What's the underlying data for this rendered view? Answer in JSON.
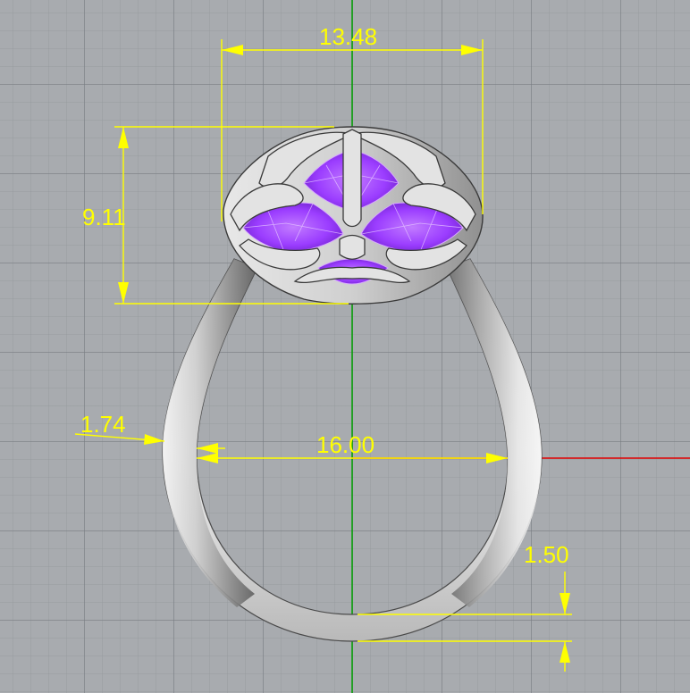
{
  "viewport": {
    "name": "Rhino front viewport",
    "colors": {
      "background": "#a8abaf",
      "grid_minor": "#969a9e",
      "grid_major": "#787c82",
      "x_axis": "#e00000",
      "y_axis": "#00a000",
      "dimension": "#ffff00",
      "metal": "#d9d9d9",
      "gem": "#9b3dff"
    }
  },
  "dimensions": {
    "top_width": "13.48",
    "head_height": "9.11",
    "shank_side": "1.74",
    "inner_diameter": "16.00",
    "band_bottom": "1.50"
  }
}
